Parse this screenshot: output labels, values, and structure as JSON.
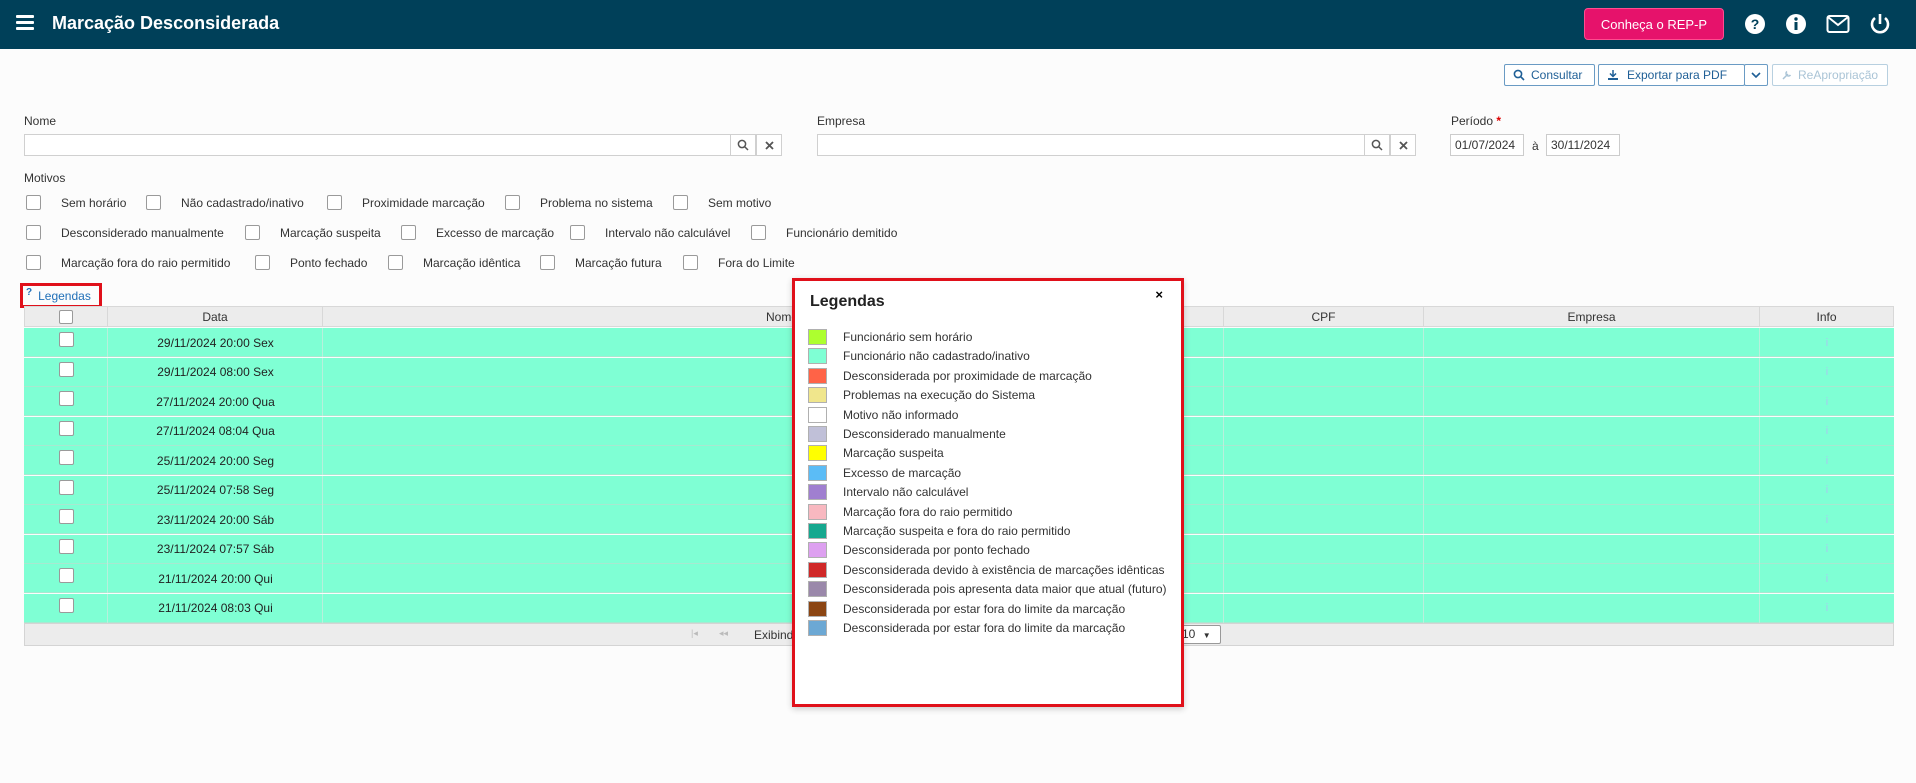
{
  "header": {
    "title": "Marcação Desconsiderada",
    "rep_button": "Conheça o REP-P",
    "icons": [
      "menu-icon",
      "help-icon",
      "info-icon",
      "mail-icon",
      "power-icon"
    ]
  },
  "toolbar": {
    "consultar": "Consultar",
    "exportar": "Exportar para PDF",
    "reapropriacao": "ReApropriação"
  },
  "filters": {
    "nome_label": "Nome",
    "nome_value": "",
    "empresa_label": "Empresa",
    "empresa_value": "",
    "periodo_label": "Período",
    "periodo_required": "*",
    "periodo_start": "01/07/2024",
    "periodo_sep": "à",
    "periodo_end": "30/11/2024",
    "motivos_label": "Motivos",
    "motivos": [
      "Sem horário",
      "Não cadastrado/inativo",
      "Proximidade marcação",
      "Problema no sistema",
      "Sem motivo",
      "Desconsiderado manualmente",
      "Marcação suspeita",
      "Excesso de marcação",
      "Intervalo não calculável",
      "Funcionário demitido",
      "Marcação fora do raio permitido",
      "Ponto fechado",
      "Marcação idêntica",
      "Marcação futura",
      "Fora do Limite"
    ]
  },
  "legend_link": {
    "icon": "?",
    "label": "Legendas"
  },
  "grid": {
    "columns": [
      "Data",
      "Nome",
      "CPF",
      "Empresa",
      "Info"
    ],
    "row_color": "#7fffd4",
    "rows": [
      "29/11/2024 20:00 Sex",
      "29/11/2024 08:00 Sex",
      "27/11/2024 20:00 Qua",
      "27/11/2024 08:04 Qua",
      "25/11/2024 20:00 Seg",
      "25/11/2024 07:58 Seg",
      "23/11/2024 20:00 Sáb",
      "23/11/2024 07:57 Sáb",
      "21/11/2024 20:00 Qui",
      "21/11/2024 08:03 Qui"
    ],
    "info_icon": "i"
  },
  "pager": {
    "text": "Exibind",
    "page_size": "10"
  },
  "legend_popup": {
    "title": "Legendas",
    "close": "×",
    "items": [
      {
        "color": "#adff2f",
        "label": "Funcionário sem horário"
      },
      {
        "color": "#7fffd4",
        "label": "Funcionário não cadastrado/inativo"
      },
      {
        "color": "#ff6347",
        "label": "Desconsiderada por proximidade de marcação"
      },
      {
        "color": "#f0e68c",
        "label": "Problemas na execução do Sistema"
      },
      {
        "color": "#ffffff",
        "label": "Motivo não informado"
      },
      {
        "color": "#c0c0d8",
        "label": "Desconsiderado manualmente"
      },
      {
        "color": "#ffff00",
        "label": "Marcação suspeita"
      },
      {
        "color": "#5bbcf6",
        "label": "Excesso de marcação"
      },
      {
        "color": "#a07fd0",
        "label": "Intervalo não calculável"
      },
      {
        "color": "#f8b8c0",
        "label": "Marcação fora do raio permitido"
      },
      {
        "color": "#16a88f",
        "label": "Marcação suspeita e fora do raio permitido"
      },
      {
        "color": "#dda0f0",
        "label": "Desconsiderada por ponto fechado"
      },
      {
        "color": "#d02828",
        "label": "Desconsiderada devido à existência de marcações idênticas"
      },
      {
        "color": "#9a88aa",
        "label": "Desconsiderada pois apresenta data maior que atual (futuro)"
      },
      {
        "color": "#8b4513",
        "label": "Desconsiderada por estar fora do limite da marcação"
      },
      {
        "color": "#6ca8d4",
        "label": "Desconsiderada por estar fora do limite da marcação"
      }
    ]
  }
}
